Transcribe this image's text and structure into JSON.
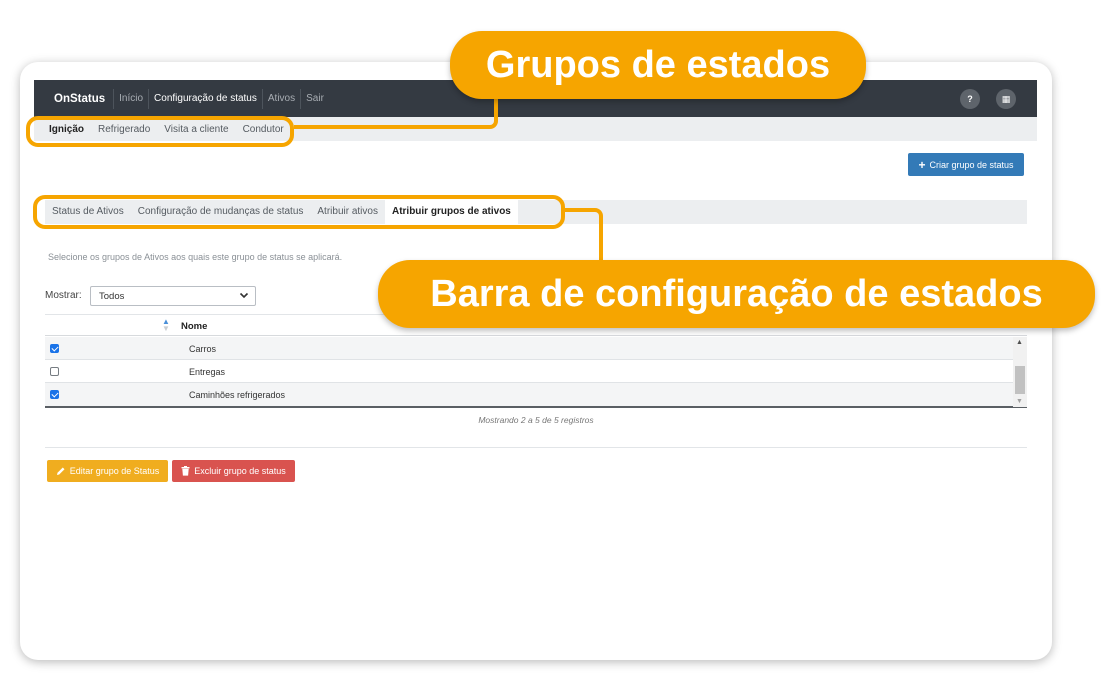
{
  "navbar": {
    "brand": "OnStatus",
    "items": [
      "Início",
      "Configuração de status",
      "Ativos",
      "Sair"
    ],
    "active_index": 1,
    "help_symbol": "?",
    "grid_symbol": "▦"
  },
  "status_groups": {
    "items": [
      "Ignição",
      "Refrigerado",
      "Visita a cliente",
      "Condutor"
    ],
    "active_index": 0
  },
  "create_button": {
    "icon": "plus-icon",
    "symbol": "+",
    "label": "Criar grupo de status"
  },
  "config_tabs": {
    "items": [
      "Status de Ativos",
      "Configuração de mudanças de status",
      "Atribuir ativos",
      "Atribuir grupos de ativos"
    ],
    "active_index": 3
  },
  "hint_text": "Selecione os grupos de Ativos aos quais este grupo de status se aplicará.",
  "filter": {
    "label": "Mostrar:",
    "value": "Todos"
  },
  "table": {
    "column_name": "Nome",
    "rows": [
      {
        "name": "Carros",
        "checked": true
      },
      {
        "name": "Entregas",
        "checked": false
      },
      {
        "name": "Caminhões refrigerados",
        "checked": true
      }
    ],
    "info": "Mostrando 2 a 5 de 5 registros"
  },
  "actions": {
    "edit_label": "Editar grupo de Status",
    "delete_label": "Excluir grupo de status"
  },
  "callouts": {
    "groups": "Grupos de estados",
    "config_bar": "Barra de configuração de estados"
  },
  "colors": {
    "accent": "#f6a500",
    "navbar": "#343a42",
    "primary": "#337ab7",
    "warning": "#f0ad1f",
    "danger": "#d9534f"
  }
}
